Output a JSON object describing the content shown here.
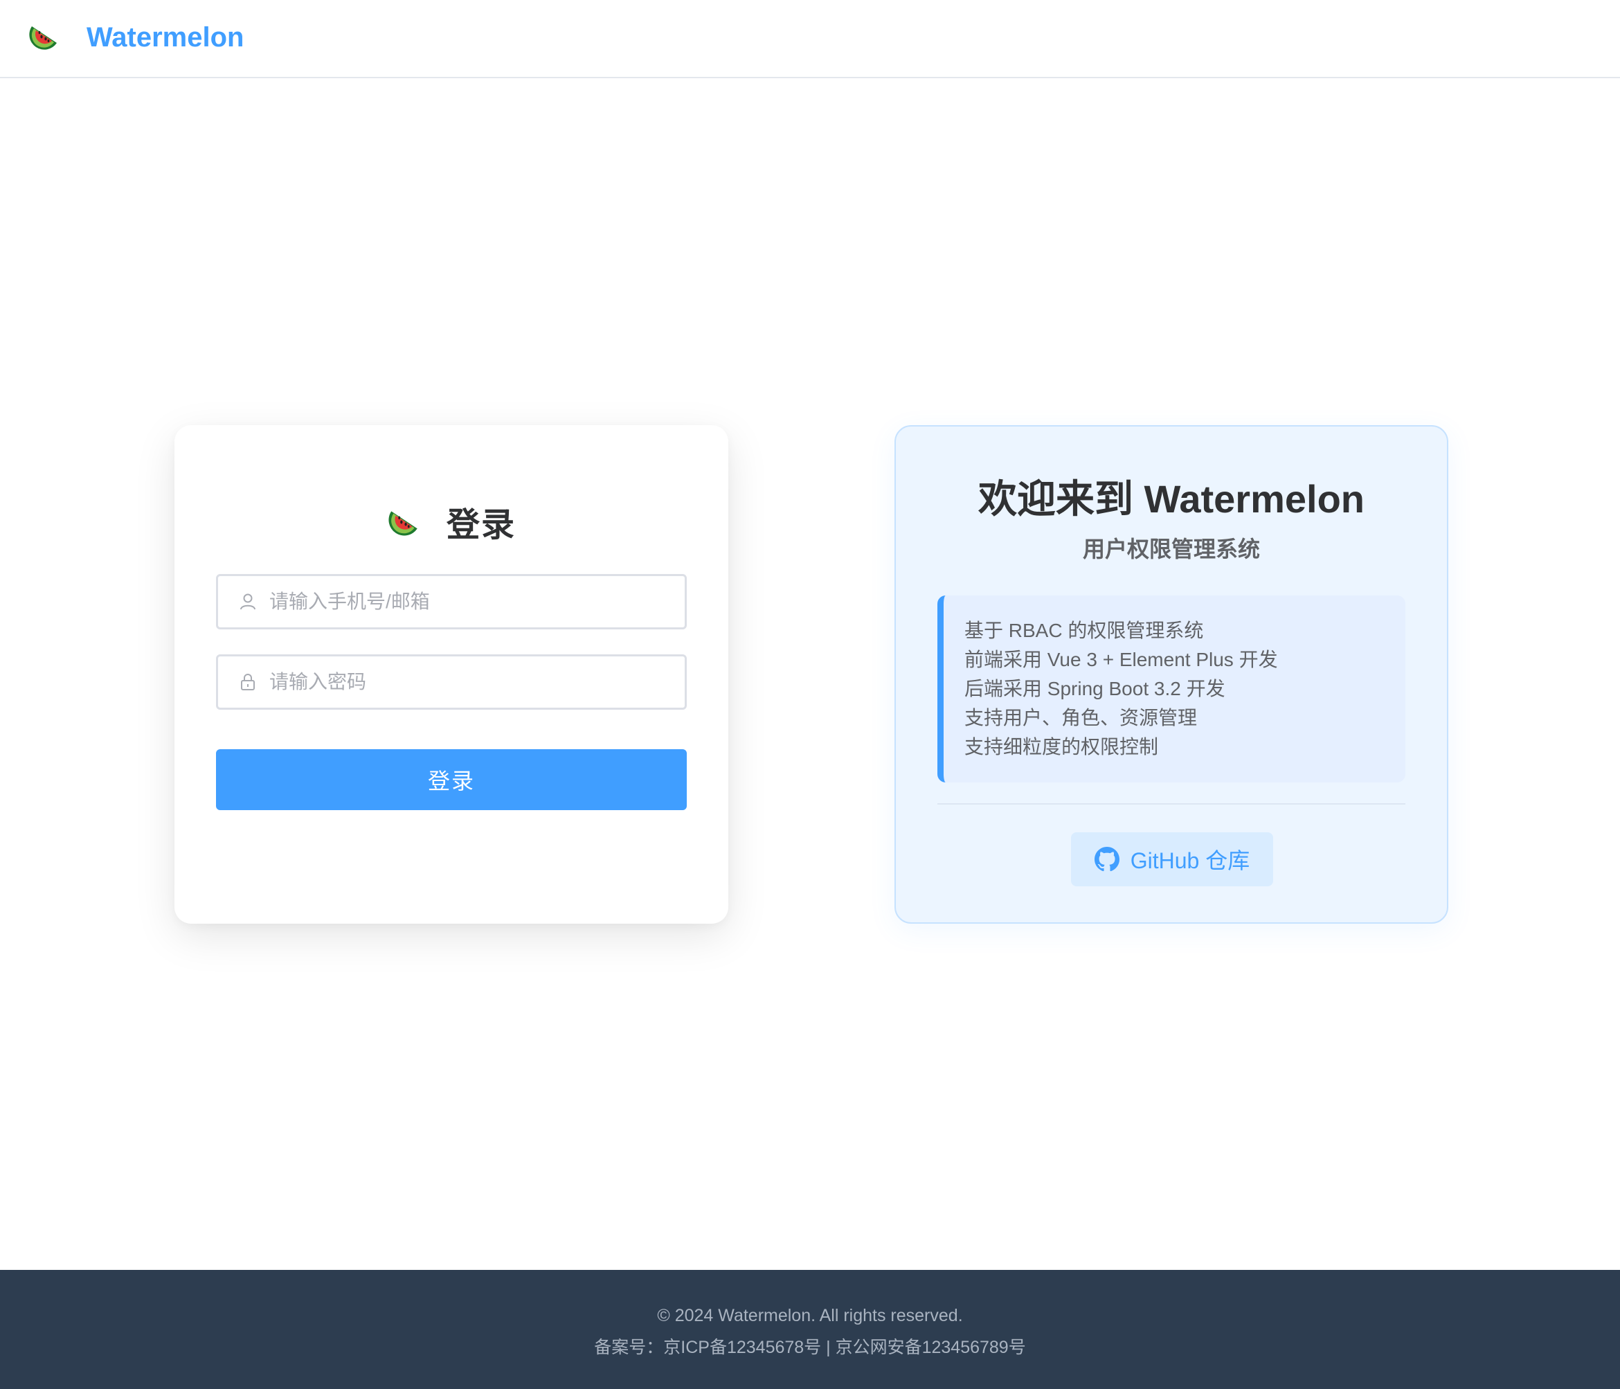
{
  "header": {
    "brand": "Watermelon",
    "logo_icon": "watermelon-icon"
  },
  "login": {
    "title": "登录",
    "logo_icon": "watermelon-icon",
    "username": {
      "placeholder": "请输入手机号/邮箱",
      "value": "",
      "icon": "user-icon"
    },
    "password": {
      "placeholder": "请输入密码",
      "value": "",
      "icon": "lock-icon"
    },
    "submit_label": "登录"
  },
  "welcome": {
    "title": "欢迎来到 Watermelon",
    "subtitle": "用户权限管理系统",
    "features": [
      "基于 RBAC 的权限管理系统",
      "前端采用 Vue 3 + Element Plus 开发",
      "后端采用 Spring Boot 3.2 开发",
      "支持用户、角色、资源管理",
      "支持细粒度的权限控制"
    ],
    "github_label": "GitHub 仓库",
    "github_icon": "github-icon"
  },
  "footer": {
    "copyright": "© 2024 Watermelon. All rights reserved.",
    "icp": "备案号：京ICP备12345678号 | 京公网安备123456789号"
  },
  "colors": {
    "accent": "#409eff",
    "footer_bg": "#2d3d50",
    "welcome_bg": "#ecf5ff"
  }
}
